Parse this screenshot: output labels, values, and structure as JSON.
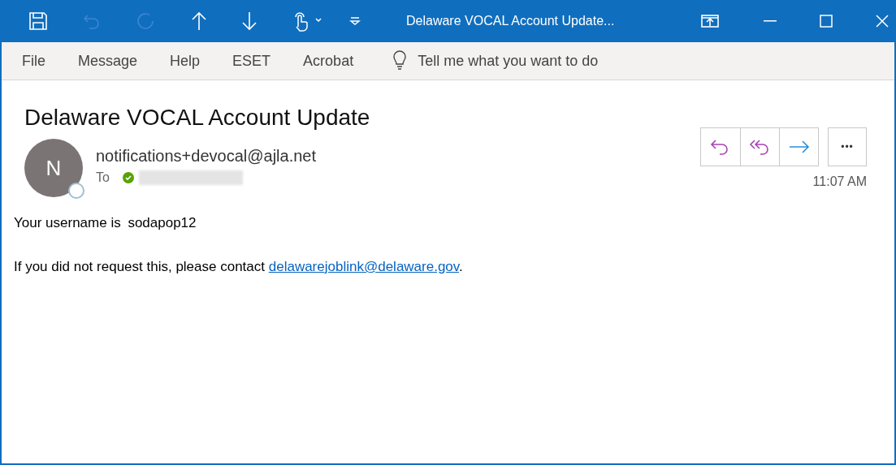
{
  "quick_access": [
    {
      "kind": "save",
      "disabled": false
    },
    {
      "kind": "undo",
      "disabled": true
    },
    {
      "kind": "redo",
      "disabled": true
    },
    {
      "kind": "up",
      "disabled": false
    },
    {
      "kind": "down",
      "disabled": false
    },
    {
      "kind": "touch",
      "disabled": false
    },
    {
      "kind": "customize",
      "disabled": false
    }
  ],
  "window": {
    "title": "Delaware VOCAL Account Update..."
  },
  "ribbon_tabs": [
    {
      "label": "File",
      "selected": false
    },
    {
      "label": "Message",
      "selected": false
    },
    {
      "label": "Help",
      "selected": false
    },
    {
      "label": "ESET",
      "selected": false
    },
    {
      "label": "Acrobat",
      "selected": false
    }
  ],
  "tell_me": {
    "placeholder": "Tell me what you want to do"
  },
  "message": {
    "subject": "Delaware VOCAL Account Update",
    "avatar_initial": "N",
    "sender": "notifications+devocal@ajla.net",
    "to_label": "To",
    "time": "11:07 AM",
    "actions": [
      {
        "kind": "reply"
      },
      {
        "kind": "reply-all"
      },
      {
        "kind": "forward"
      }
    ],
    "more": "•••",
    "body": [
      {
        "text": "Your username is ",
        "value": "sodapop12"
      },
      {
        "text": "If you did not request this, please contact ",
        "link": "delawarejoblink@delaware.gov",
        "after": "."
      }
    ]
  }
}
